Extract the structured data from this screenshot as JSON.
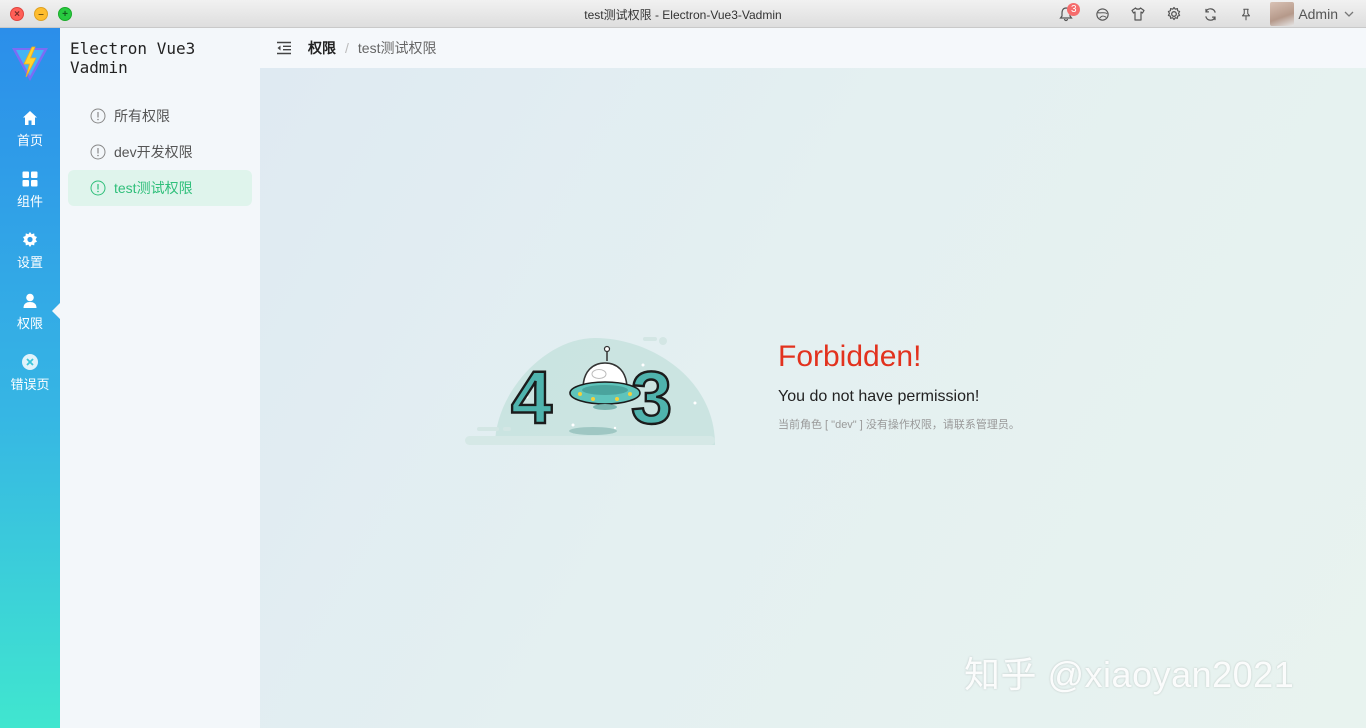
{
  "window": {
    "title": "test测试权限 - Electron-Vue3-Vadmin",
    "close": "×",
    "minimize": "–",
    "maximize": "+"
  },
  "toolbar": {
    "notification_count": "3",
    "user_name": "Admin"
  },
  "rail": {
    "items": [
      {
        "label": "首页",
        "icon": "home-icon"
      },
      {
        "label": "组件",
        "icon": "grid-icon"
      },
      {
        "label": "设置",
        "icon": "gear-icon"
      },
      {
        "label": "权限",
        "icon": "user-icon",
        "active": true
      },
      {
        "label": "错误页",
        "icon": "close-circle-icon"
      }
    ]
  },
  "sidebar": {
    "app_name": "Electron Vue3 Vadmin",
    "items": [
      {
        "label": "所有权限",
        "icon": "info-circle-icon"
      },
      {
        "label": "dev开发权限",
        "icon": "info-circle-icon"
      },
      {
        "label": "test测试权限",
        "icon": "info-circle-icon",
        "active": true
      }
    ]
  },
  "breadcrumb": {
    "parent": "权限",
    "separator": "/",
    "current": "test测试权限"
  },
  "error": {
    "digit_left": "4",
    "digit_right": "3",
    "title": "Forbidden!",
    "subtitle": "You do not have permission!",
    "detail": "当前角色 [ \"dev\" ] 没有操作权限，请联系管理员。"
  },
  "watermark": "知乎 @xiaoyan2021",
  "colors": {
    "accent": "#2fbf7a",
    "error": "#e2321e",
    "rail_top": "#2b8eea",
    "rail_bottom": "#40e6cf"
  }
}
